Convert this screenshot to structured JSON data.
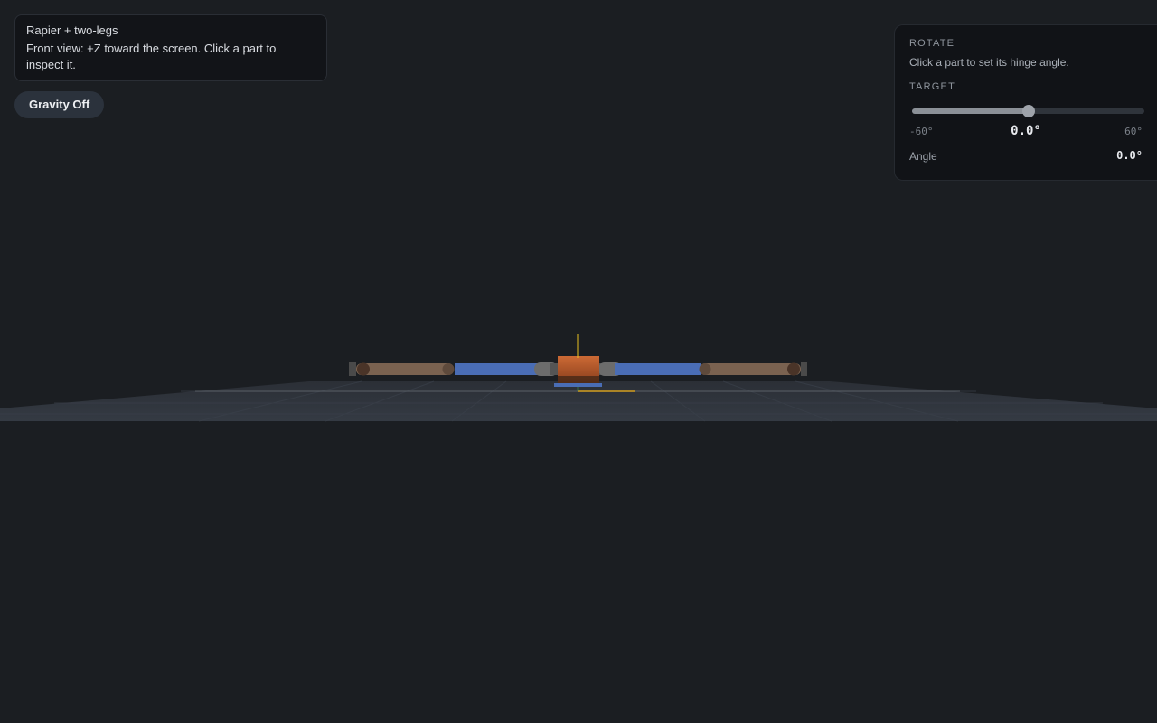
{
  "info": {
    "title": "Rapier + two-legs",
    "description": "Front view: +Z toward the screen. Click a part to inspect it."
  },
  "gravity_button": {
    "label": "Gravity Off"
  },
  "rotate_panel": {
    "section_label": "ROTATE",
    "hint": "Click a part to set its hinge angle.",
    "target_label": "TARGET",
    "slider": {
      "min": -60,
      "max": 60,
      "value": 0
    },
    "min_label": "-60°",
    "max_label": "60°",
    "target_value": "0.0°",
    "angle_label": "Angle",
    "angle_value": "0.0°"
  },
  "scene": {
    "background": "#1b1e22",
    "ground_color": "#2e333b",
    "grid_color": "#3a404a",
    "body_color": "#c0622f",
    "upper_leg_color": "#4a6db5",
    "lower_leg_color": "#7a6250",
    "joint_color": "#707070",
    "foot_color": "#4a4a4a",
    "axis_x_color": "#d4a020",
    "axis_y_color": "#e8c020",
    "axis_z_color": "#40b050"
  }
}
